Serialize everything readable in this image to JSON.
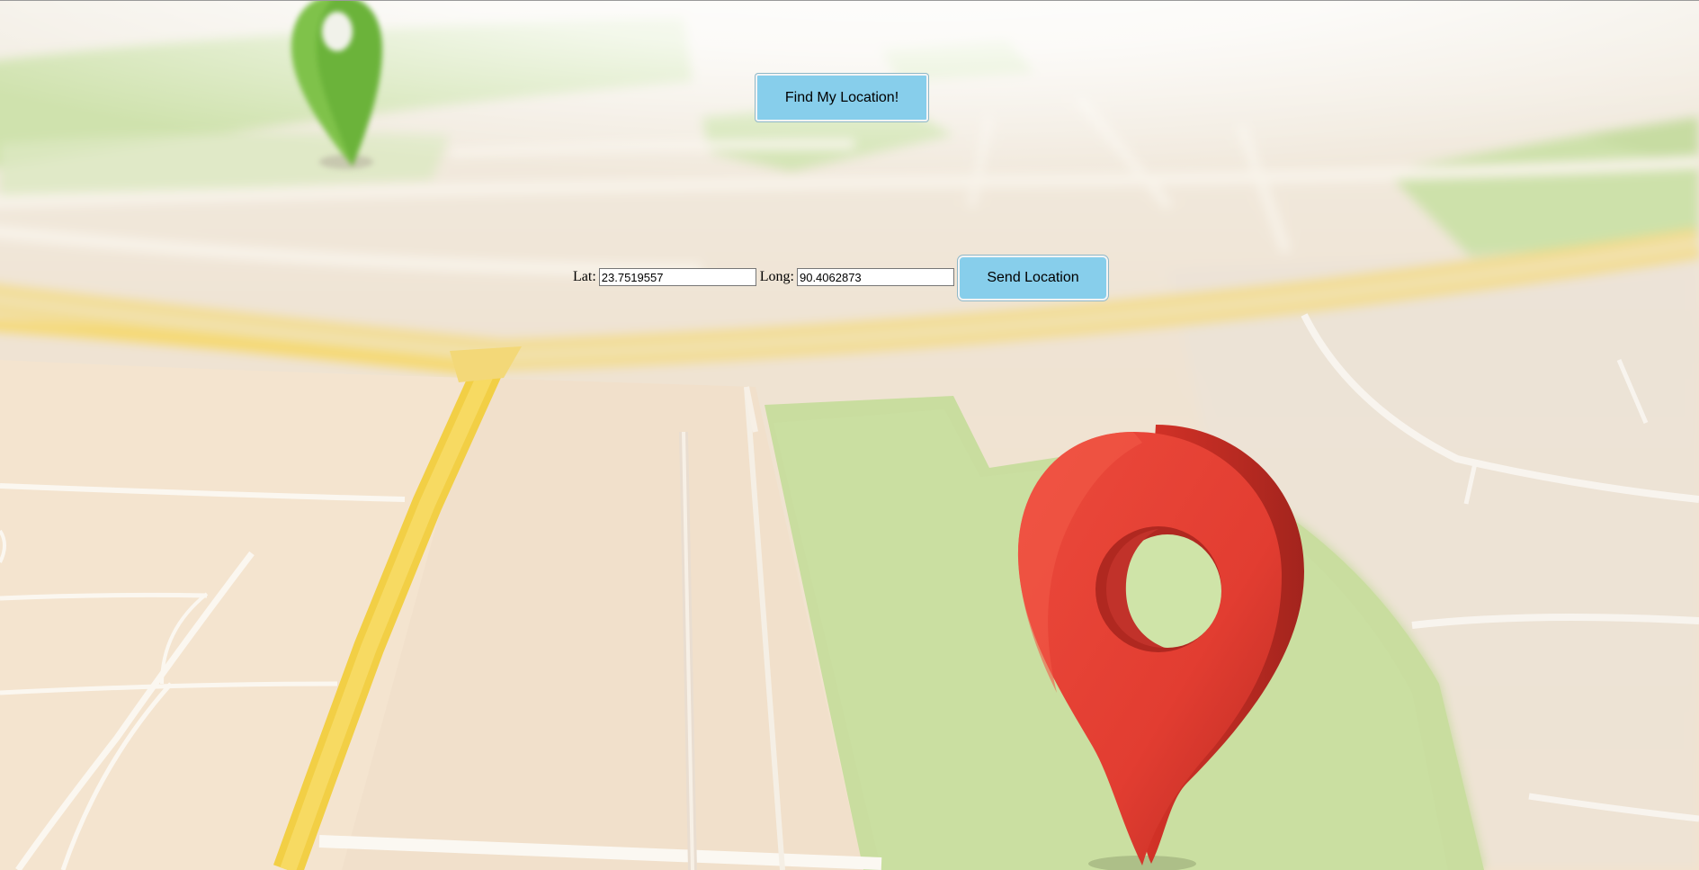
{
  "find_button": {
    "label": "Find My Location!"
  },
  "coordinates": {
    "lat_label": "Lat:",
    "lat_value": "23.7519557",
    "long_label": "Long:",
    "long_value": "90.4062873"
  },
  "send_button": {
    "label": "Send Location"
  },
  "colors": {
    "button_bg": "#87ceeb",
    "map_ground": "#f1e6d8",
    "park_green": "#c8de9c",
    "road_yellow": "#f6d24a",
    "pin_red": "#e8443a",
    "pin_green": "#6bb33a"
  },
  "icons": {
    "large_pin": "map-pin-icon",
    "small_pin": "map-pin-icon"
  }
}
